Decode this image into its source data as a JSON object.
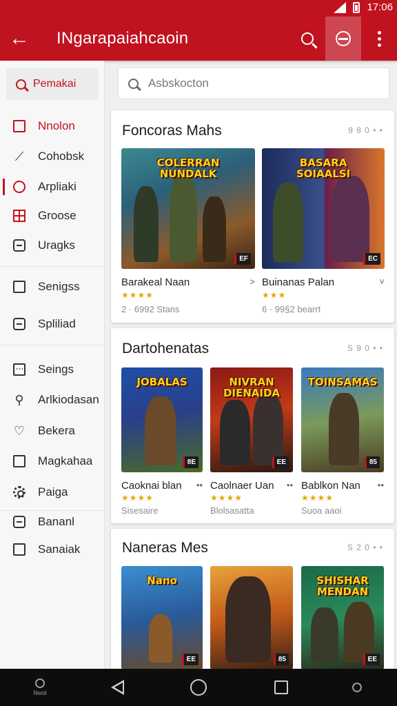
{
  "status_bar": {
    "time": "17:06"
  },
  "app_bar": {
    "title": "INgarapaiahcaoin",
    "back_label": "←"
  },
  "sidebar": {
    "search_label": "Pemakai",
    "items": [
      {
        "label": "Nnolon",
        "icon": "square-icon"
      },
      {
        "label": "Cohobsk",
        "icon": "pin-icon"
      },
      {
        "label": "Arpliaki",
        "icon": "user-icon"
      },
      {
        "label": "Groose",
        "icon": "grid-icon"
      },
      {
        "label": "Uragks",
        "icon": "document-icon"
      },
      {
        "label": "Senigss",
        "icon": "tag-icon"
      },
      {
        "label": "Spliliad",
        "icon": "list-icon"
      },
      {
        "label": "Seings",
        "icon": "calendar-icon"
      },
      {
        "label": "Arlkiodasan",
        "icon": "search-user-icon"
      },
      {
        "label": "Bekera",
        "icon": "heart-icon"
      },
      {
        "label": "Magkahaa",
        "icon": "chart-icon"
      },
      {
        "label": "Paiga",
        "icon": "gear-icon"
      },
      {
        "label": "Bananl",
        "icon": "bag-icon"
      },
      {
        "label": "Sanaiak",
        "icon": "page-icon"
      }
    ]
  },
  "search": {
    "placeholder": "Asbskocton"
  },
  "sections": [
    {
      "title": "Foncoras Mahs",
      "more": "9 8 0 • •",
      "tiles": [
        {
          "thumb_label": "COLERRAN\nNUNDALK",
          "rating_badge": "EF",
          "name": "Barakeal Naan",
          "dots": ">",
          "stars": "★★★★",
          "meta": "2 · 6992 Stans"
        },
        {
          "thumb_label": "BASARA\nSOIAALSI",
          "rating_badge": "EC",
          "name": "Buinanas Palan",
          "dots": "˅",
          "stars": "★★★",
          "meta": "6 · 99§2 bearrt"
        }
      ]
    },
    {
      "title": "Dartohenatas",
      "more": "S 9 0 • •",
      "tiles": [
        {
          "thumb_label": "JOBALAS",
          "rating_badge": "8E",
          "name": "Caoknai blan",
          "dots": "••",
          "stars": "★★★★",
          "meta": "Sisesaire"
        },
        {
          "thumb_label": "NIVRAN\nDIENAIDA",
          "rating_badge": "EE",
          "name": "Caolnaer Uan",
          "dots": "••",
          "stars": "★★★★",
          "meta": "Blolsasatta"
        },
        {
          "thumb_label": "TOINSAMAS",
          "rating_badge": "85",
          "name": "Bablkon Nan",
          "dots": "••",
          "stars": "★★★★",
          "meta": "Suoa aaoi"
        }
      ]
    },
    {
      "title": "Naneras Mes",
      "more": "S 2 0 • •",
      "tiles": [
        {
          "thumb_label": "Nano",
          "rating_badge": "EE"
        },
        {
          "thumb_label": "",
          "rating_badge": "85"
        },
        {
          "thumb_label": "SHISHAR\nMENDAN",
          "rating_badge": "EE"
        }
      ]
    }
  ],
  "navbar": {
    "left_label": "Nwsl"
  },
  "colors": {
    "accent": "#c1121f",
    "background": "#efefef",
    "card": "#ffffff",
    "star": "#e7a400"
  }
}
